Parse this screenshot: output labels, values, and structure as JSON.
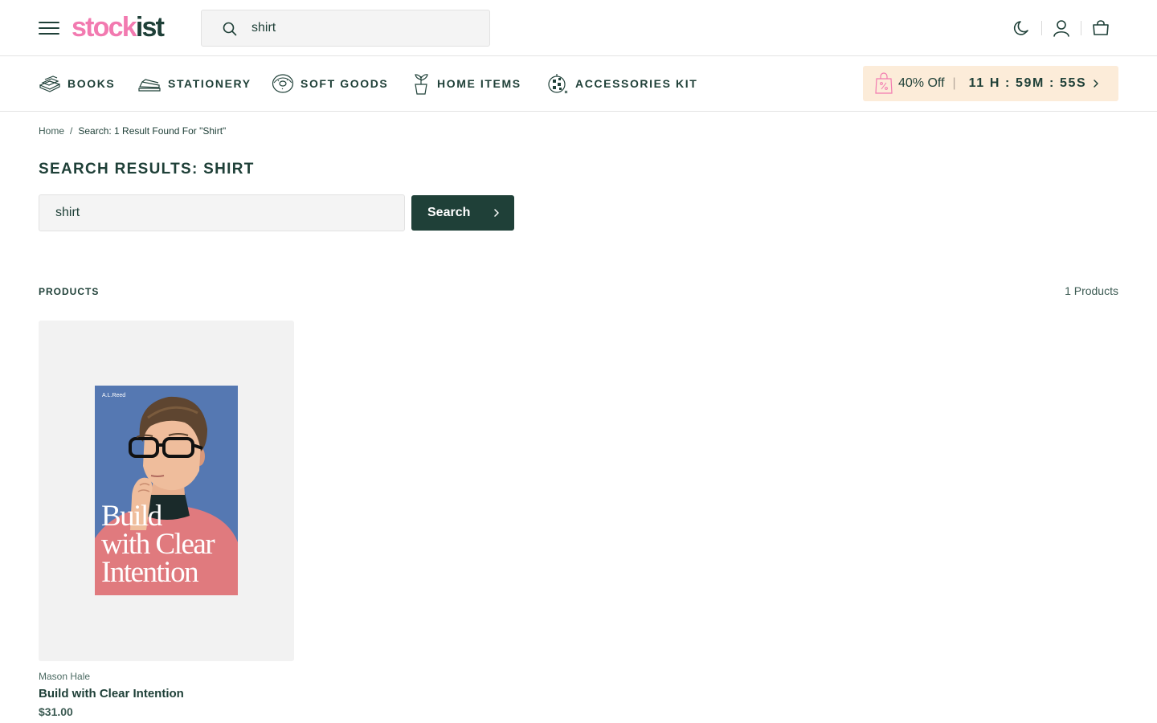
{
  "header": {
    "logo_part1": "stock",
    "logo_part2": "ist",
    "search_value": "shirt",
    "icons": [
      "menu-icon",
      "search-icon",
      "moon-icon",
      "user-icon",
      "cart-icon"
    ]
  },
  "nav": {
    "items": [
      {
        "label": "BOOKS",
        "icon": "books-icon"
      },
      {
        "label": "STATIONERY",
        "icon": "stapler-icon"
      },
      {
        "label": "SOFT GOODS",
        "icon": "donut-icon"
      },
      {
        "label": "HOME ITEMS",
        "icon": "plant-icon"
      },
      {
        "label": "ACCESSORIES KIT",
        "icon": "disco-ball-icon"
      }
    ],
    "promo": {
      "discount": "40% Off",
      "separator": "|",
      "timer": "11 H : 59M : 55S"
    }
  },
  "breadcrumb": {
    "home": "Home",
    "separator": "/",
    "current": "Search: 1 Result Found For \"Shirt\""
  },
  "page_title": "SEARCH RESULTS: SHIRT",
  "search": {
    "value": "shirt",
    "button_label": "Search"
  },
  "products": {
    "label": "PRODUCTS",
    "count": "1 Products",
    "items": [
      {
        "cover_author": "A.L.Reed",
        "cover_title_lines": [
          "Build",
          "with Clear",
          "Intention"
        ],
        "vendor": "Mason Hale",
        "title": "Build with Clear Intention",
        "price": "$31.00"
      }
    ]
  },
  "colors": {
    "brand_pink": "#f27ab0",
    "brand_green": "#1f4038",
    "promo_bg": "#fcecd9",
    "cover_blue": "#5578b2",
    "sweater_pink": "#e07a7e"
  }
}
